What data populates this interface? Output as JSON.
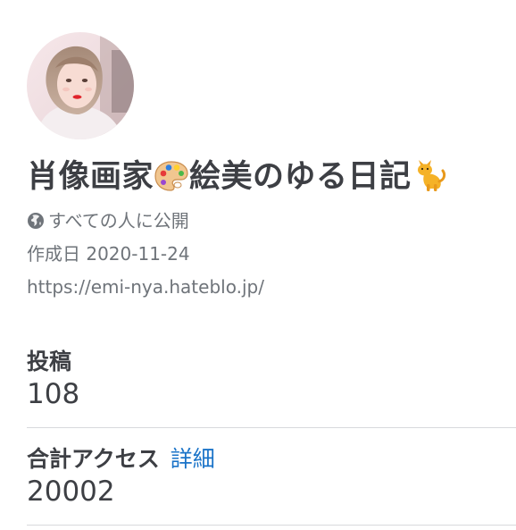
{
  "blog": {
    "title_part1": "肖像画家",
    "title_part2": "絵美のゆる日記",
    "title_emoji_1": "palette-icon",
    "title_emoji_2": "cat-icon",
    "visibility": "すべての人に公開",
    "visibility_icon": "globe-icon",
    "created": "作成日 2020-11-24",
    "url": "https://emi-nya.hateblo.jp/"
  },
  "stats": {
    "posts_label": "投稿",
    "posts_value": "108",
    "access_label": "合計アクセス",
    "access_link": "詳細",
    "access_value": "20002"
  },
  "colors": {
    "text": "#3d3f44",
    "muted": "#6f747a",
    "link": "#1a73c8",
    "divider": "#d8d9dc"
  }
}
